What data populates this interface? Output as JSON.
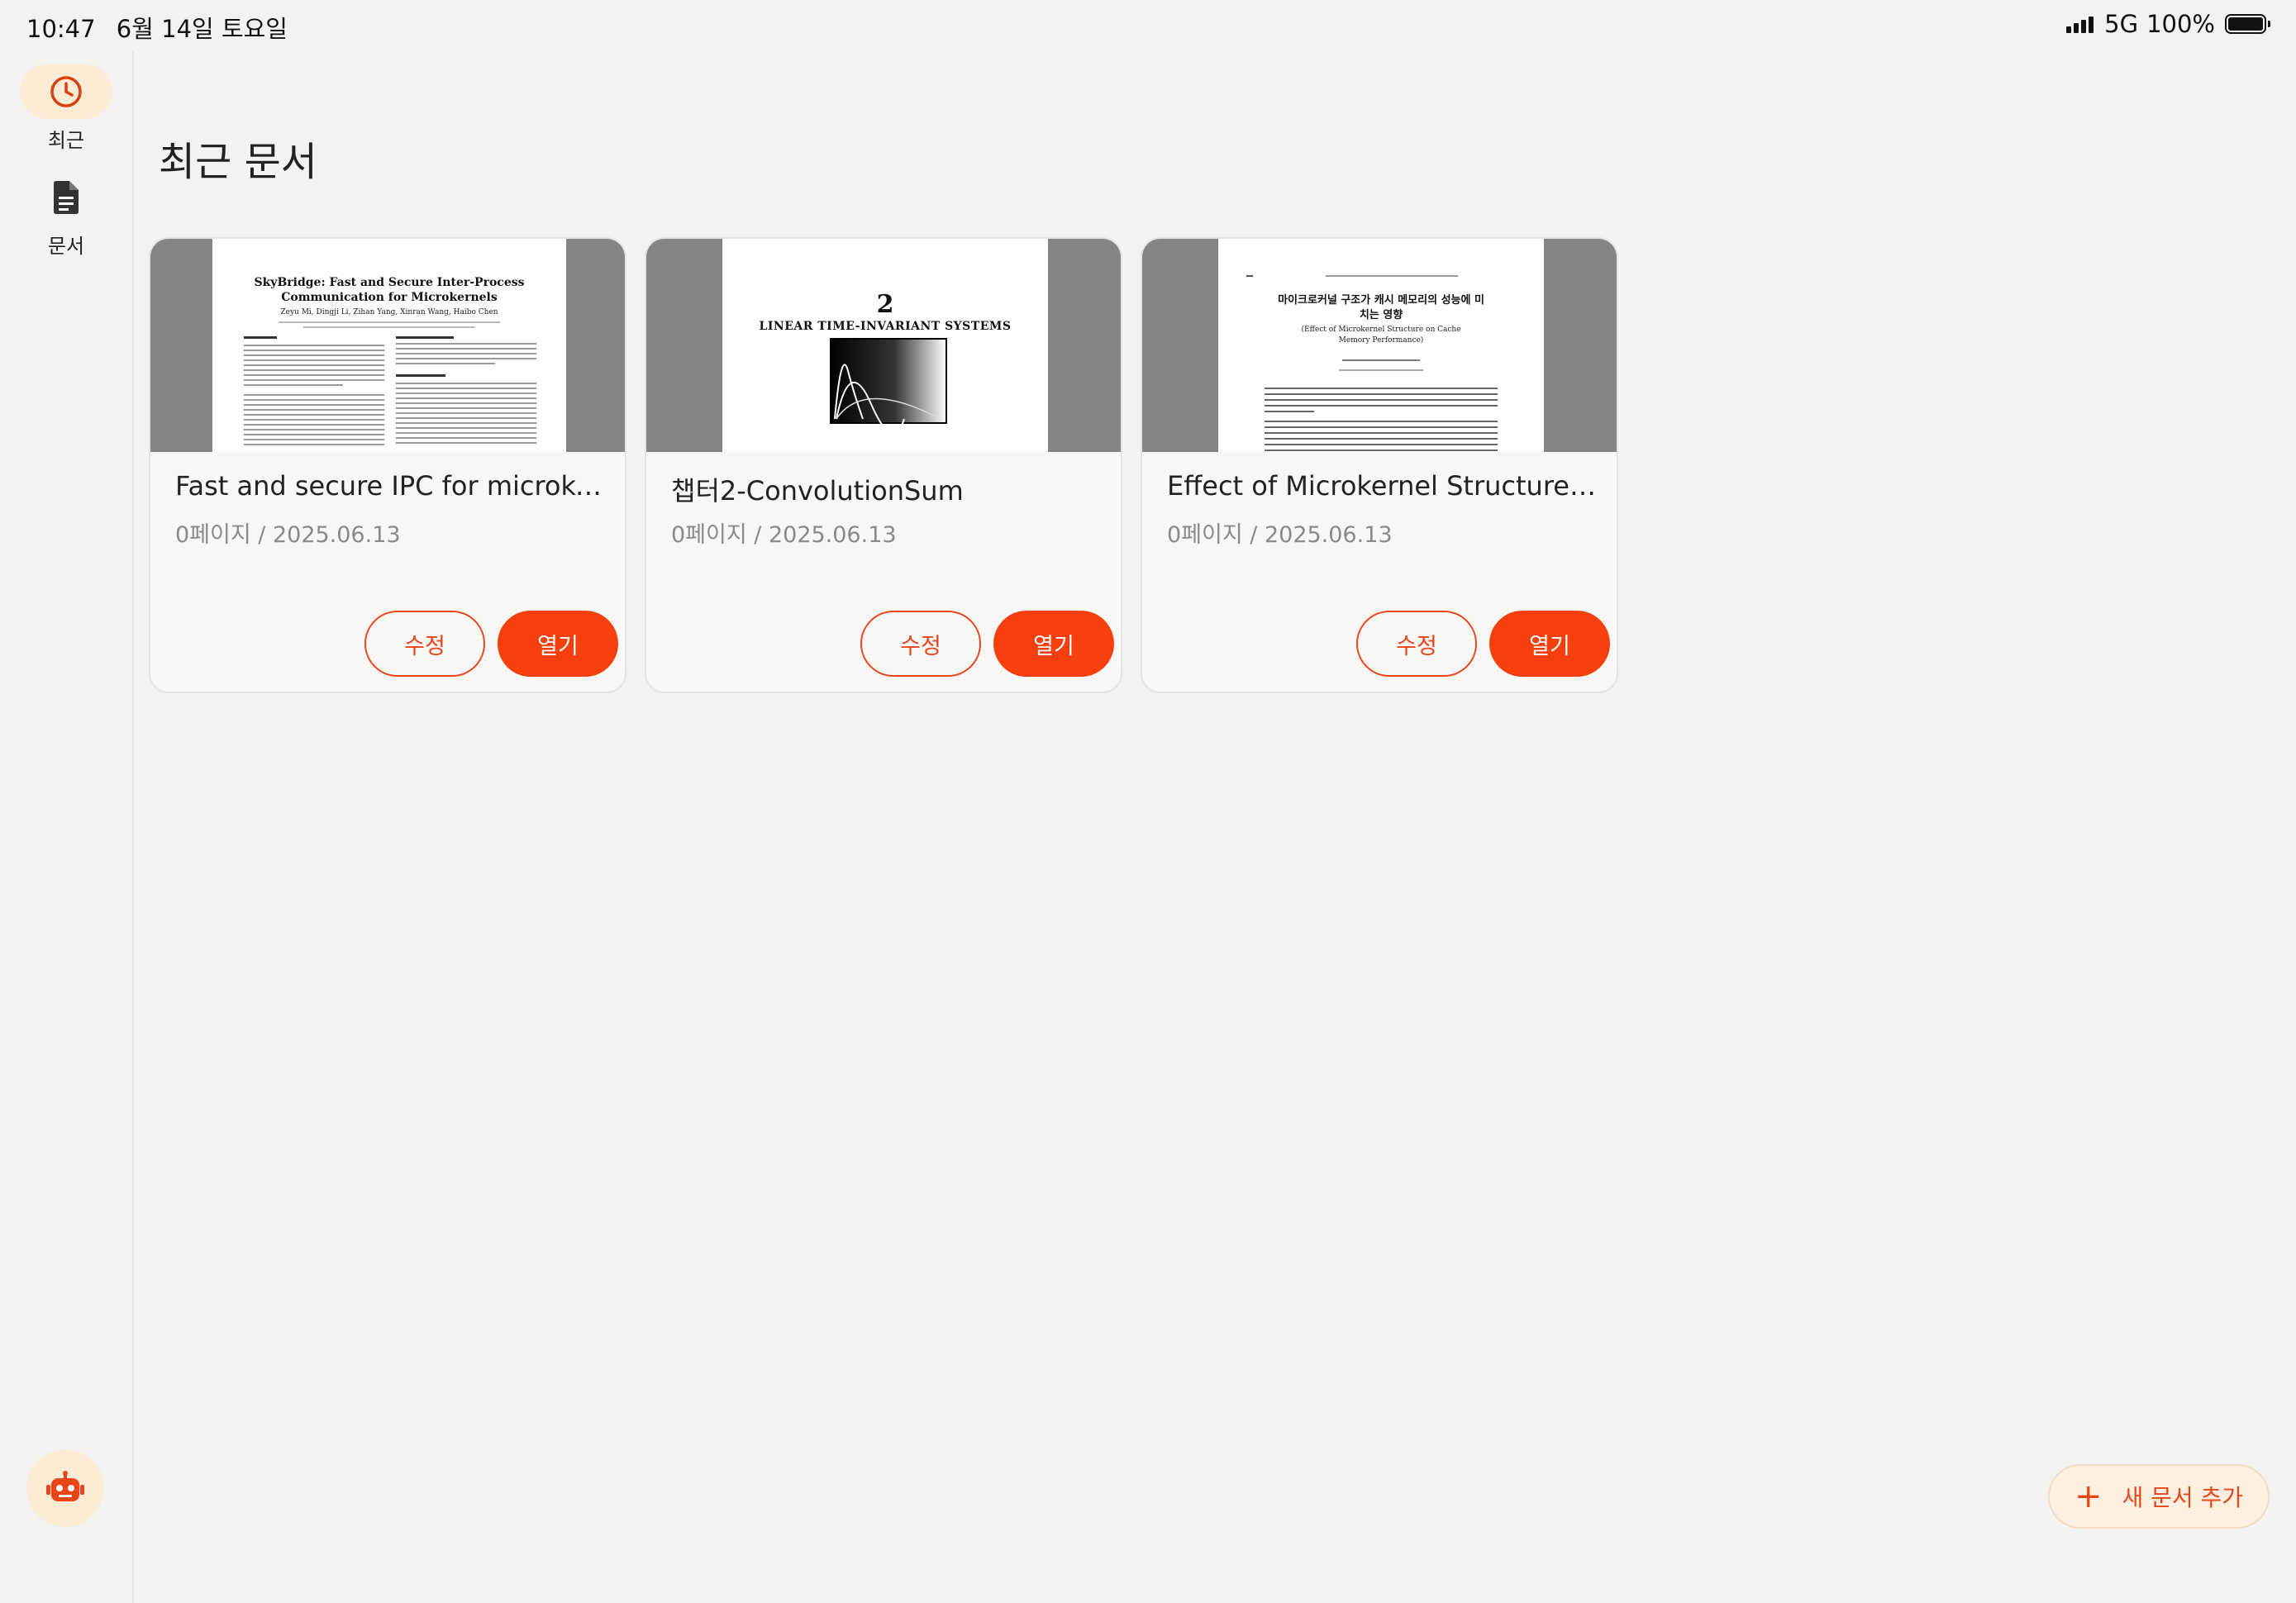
{
  "status_bar": {
    "time": "10:47",
    "date": "6월 14일 토요일",
    "network": "5G",
    "battery": "100%"
  },
  "sidebar": {
    "items": [
      {
        "label": "최근",
        "icon": "clock-icon",
        "active": true
      },
      {
        "label": "문서",
        "icon": "document-icon",
        "active": false
      }
    ],
    "assistant_icon": "robot-icon"
  },
  "main": {
    "title": "최근 문서",
    "documents": [
      {
        "title": "Fast and secure IPC for microker...",
        "meta": "0페이지 / 2025.06.13",
        "edit_label": "수정",
        "open_label": "열기",
        "thumbnail": {
          "heading": "SkyBridge: Fast and Secure Inter-Process Communication for Microkernels",
          "authors": "Zeyu Mi, Dingji Li, Zihan Yang, Xinran Wang, Haibo Chen"
        }
      },
      {
        "title": "챕터2-ConvolutionSum",
        "meta": "0페이지 / 2025.06.13",
        "edit_label": "수정",
        "open_label": "열기",
        "thumbnail": {
          "chapter": "2",
          "heading": "LINEAR TIME-INVARIANT SYSTEMS"
        }
      },
      {
        "title": "Effect of Microkernel Structure o...",
        "meta": "0페이지 / 2025.06.13",
        "edit_label": "수정",
        "open_label": "열기",
        "thumbnail": {
          "heading": "마이크로커널 구조가 캐시 메모리의 성능에 미치는 영향",
          "subheading": "(Effect of Microkernel Structure on Cache Memory Performance)"
        }
      }
    ]
  },
  "fab": {
    "label": "새 문서 추가",
    "icon": "plus-icon"
  },
  "colors": {
    "accent": "#f5400e",
    "accent_soft": "#fdebd6",
    "background": "#f2f2f0"
  }
}
